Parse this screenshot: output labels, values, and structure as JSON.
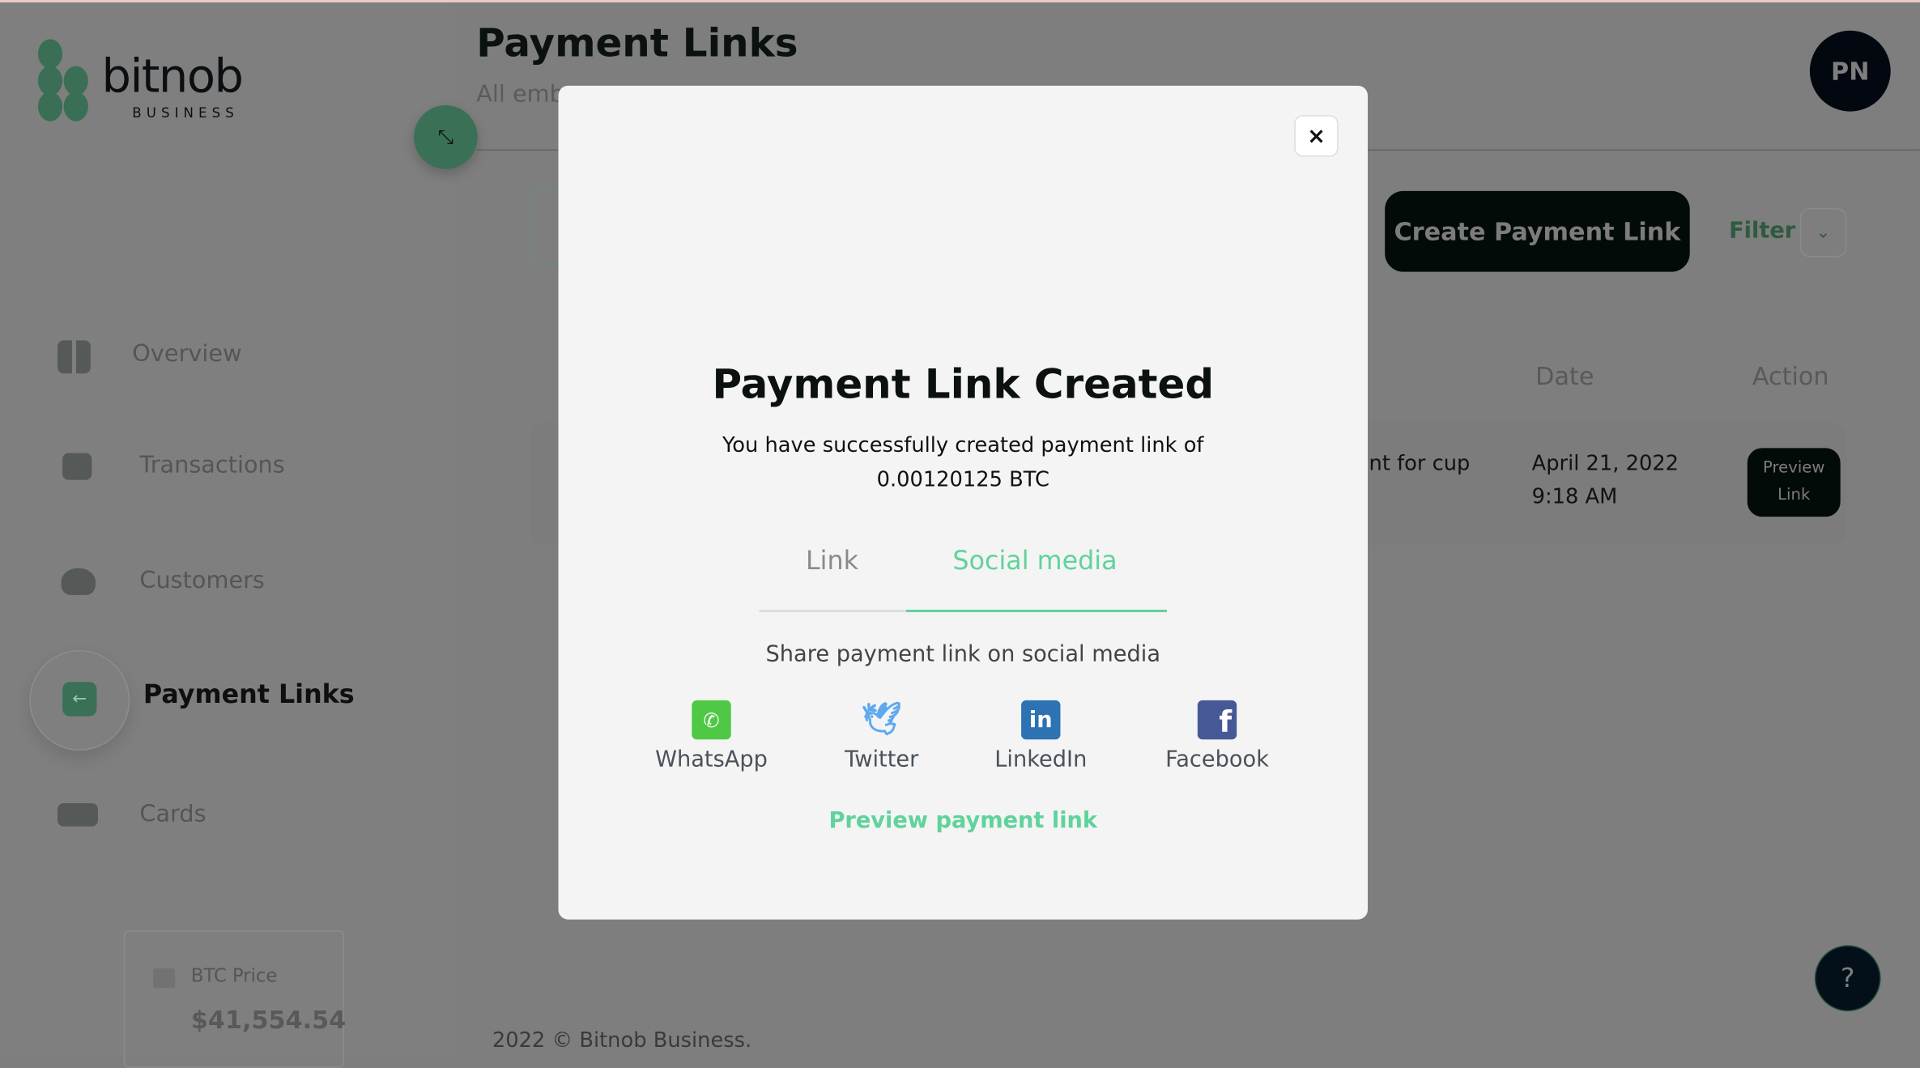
{
  "brand": {
    "name": "bitnob",
    "sub": "BUSINESS"
  },
  "header": {
    "title": "Payment Links",
    "subtitle": "All emb",
    "avatar": "PN"
  },
  "sidebar": {
    "items": [
      {
        "label": "Overview"
      },
      {
        "label": "Transactions"
      },
      {
        "label": "Customers"
      },
      {
        "label": "Payment Links",
        "active": true
      },
      {
        "label": "Cards"
      }
    ],
    "btc": {
      "label": "BTC Price",
      "value": "$41,554.54"
    }
  },
  "toolbar": {
    "create": "Create Payment Link",
    "filter": "Filter"
  },
  "table": {
    "headers": [
      "Date",
      "Action"
    ],
    "rows": [
      {
        "description": "nt for cup",
        "date": "April 21, 2022",
        "time": "9:18 AM",
        "action": "Preview Link"
      }
    ]
  },
  "footer": "2022 © Bitnob Business.",
  "help": "?",
  "modal": {
    "close": "×",
    "title": "Payment Link Created",
    "desc": "You have successfully created payment link of 0.00120125 BTC",
    "tabs": [
      {
        "label": "Link",
        "active": false
      },
      {
        "label": "Social media",
        "active": true
      }
    ],
    "share_text": "Share payment link on social media",
    "social": [
      {
        "label": "WhatsApp",
        "icon": "whatsapp-icon",
        "color": "#4fc846"
      },
      {
        "label": "Twitter",
        "icon": "twitter-icon",
        "color": "#5ea9ee"
      },
      {
        "label": "LinkedIn",
        "icon": "linkedin-icon",
        "color": "#2d72b3"
      },
      {
        "label": "Facebook",
        "icon": "facebook-icon",
        "color": "#475897"
      }
    ],
    "preview": "Preview payment link"
  },
  "colors": {
    "accent": "#5fd39b",
    "brand_green": "#3a7156",
    "dark": "#030b08"
  }
}
